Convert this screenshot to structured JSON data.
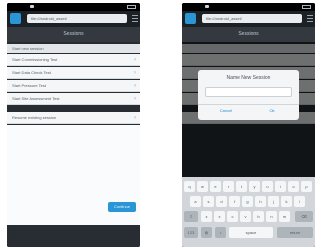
{
  "left": {
    "url": "file:///android_asset/",
    "title": "Sessions",
    "section1": "Start new session",
    "items": [
      "Start Commissioning Test",
      "Start Data Check Test",
      "Start Pressure Test",
      "Start Site Assessment Test"
    ],
    "section2": "Resume existing session",
    "continue": "Continue"
  },
  "right": {
    "url": "file:///android_asset/",
    "title": "Sessions",
    "dialog": {
      "title": "Name New Session",
      "cancel": "Cancel",
      "ok": "Ok"
    },
    "keyboard": {
      "row1": [
        "q",
        "w",
        "e",
        "r",
        "t",
        "y",
        "u",
        "i",
        "o",
        "p"
      ],
      "row2": [
        "a",
        "s",
        "d",
        "f",
        "g",
        "h",
        "j",
        "k",
        "l"
      ],
      "row3": [
        "z",
        "x",
        "c",
        "v",
        "b",
        "n",
        "m"
      ],
      "space": "space",
      "return": "return"
    }
  },
  "colors": {
    "accent": "#2b96d6",
    "header": "#33393f",
    "dark_bg": "#272d33"
  }
}
